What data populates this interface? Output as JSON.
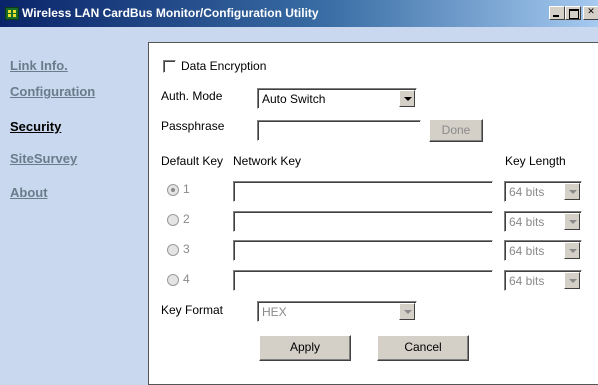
{
  "window": {
    "title": "Wireless LAN CardBus Monitor/Configuration Utility",
    "icon": "network-card-icon"
  },
  "sidebar": {
    "items": [
      {
        "label": "Link Info.",
        "active": false
      },
      {
        "label": "Configuration",
        "active": false
      },
      {
        "label": "Security",
        "active": true
      },
      {
        "label": "SiteSurvey",
        "active": false
      },
      {
        "label": "About",
        "active": false
      }
    ]
  },
  "security": {
    "data_encryption_label": "Data Encryption",
    "data_encryption_checked": false,
    "auth_mode_label": "Auth. Mode",
    "auth_mode_value": "Auto Switch",
    "passphrase_label": "Passphrase",
    "passphrase_value": "",
    "done_label": "Done",
    "default_key_header": "Default Key",
    "network_key_header": "Network Key",
    "key_length_header": "Key Length",
    "keys": [
      {
        "index": "1",
        "selected": true,
        "value": "",
        "length": "64 bits"
      },
      {
        "index": "2",
        "selected": false,
        "value": "",
        "length": "64 bits"
      },
      {
        "index": "3",
        "selected": false,
        "value": "",
        "length": "64 bits"
      },
      {
        "index": "4",
        "selected": false,
        "value": "",
        "length": "64 bits"
      }
    ],
    "key_format_label": "Key Format",
    "key_format_value": "HEX",
    "apply_label": "Apply",
    "cancel_label": "Cancel"
  }
}
